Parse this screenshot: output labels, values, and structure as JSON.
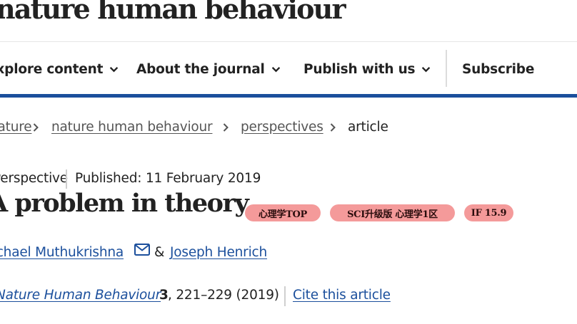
{
  "masthead": {
    "title": "nature human behaviour"
  },
  "nav": {
    "items": [
      {
        "label": "Explore content"
      },
      {
        "label": "About the journal"
      },
      {
        "label": "Publish with us"
      }
    ],
    "subscribe": "Subscribe"
  },
  "breadcrumb": {
    "items": [
      "nature",
      "nature human behaviour",
      "perspectives"
    ],
    "current": "article"
  },
  "article": {
    "type": "Perspective",
    "published": "Published: 11 February 2019",
    "title": "A problem in theory",
    "tags": [
      "心理学TOP",
      "SCI升级版 心理学1区",
      "IF 15.9"
    ],
    "authors": [
      "Michael Muthukrishna",
      "Joseph Henrich"
    ],
    "author_separator": "&",
    "journal": "Nature Human Behaviour",
    "volume": "3",
    "pages_year": ", 221–229 (2019)",
    "cite_label": "Cite this article"
  },
  "colors": {
    "brand_blue": "#1b4f9c",
    "tag_bg": "#f49a9a",
    "text": "#222222"
  },
  "icons": {
    "nav_chevron": "chevron-down-icon",
    "breadcrumb_sep": "chevron-right-icon",
    "mail": "mail-icon"
  }
}
